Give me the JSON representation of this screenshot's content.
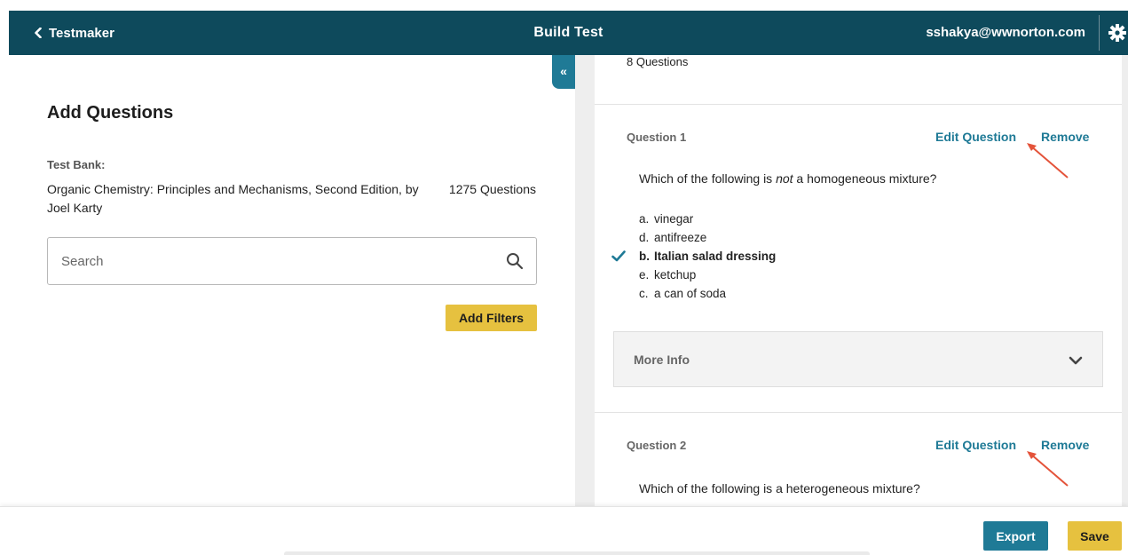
{
  "colors": {
    "topbar": "#0e4a5c",
    "accent": "#1f7a96",
    "yellow": "#e6c13f",
    "arrow": "#e4533a"
  },
  "topbar": {
    "back_label": "Testmaker",
    "back_icon": "chevron-left-icon",
    "title": "Build Test",
    "user_email": "sshakya@wwnorton.com",
    "settings_icon": "gear-icon"
  },
  "left": {
    "heading": "Add Questions",
    "test_bank_label": "Test Bank:",
    "test_bank_name": "Organic Chemistry: Principles and Mechanisms, Second Edition, by Joel Karty",
    "test_bank_count": "1275 Questions",
    "search": {
      "placeholder": "Search",
      "value": "",
      "icon": "search-icon"
    },
    "add_filters_label": "Add Filters",
    "collapse_label": "«"
  },
  "right": {
    "question_count": "8 Questions",
    "questions": [
      {
        "heading": "Question 1",
        "edit_label": "Edit Question",
        "remove_label": "Remove",
        "text_before": "Which of the following is ",
        "text_em": "not",
        "text_after": " a homogeneous mixture?",
        "answers": [
          {
            "letter": "a.",
            "text": "vinegar",
            "correct": false
          },
          {
            "letter": "d.",
            "text": "antifreeze",
            "correct": false
          },
          {
            "letter": "b.",
            "text": "Italian salad dressing",
            "correct": true
          },
          {
            "letter": "e.",
            "text": "ketchup",
            "correct": false
          },
          {
            "letter": "c.",
            "text": "a can of soda",
            "correct": false
          }
        ],
        "more_info_label": "More Info"
      },
      {
        "heading": "Question 2",
        "edit_label": "Edit Question",
        "remove_label": "Remove",
        "text": "Which of the following is a heterogeneous mixture?"
      }
    ]
  },
  "bottom": {
    "export_label": "Export",
    "save_label": "Save"
  }
}
